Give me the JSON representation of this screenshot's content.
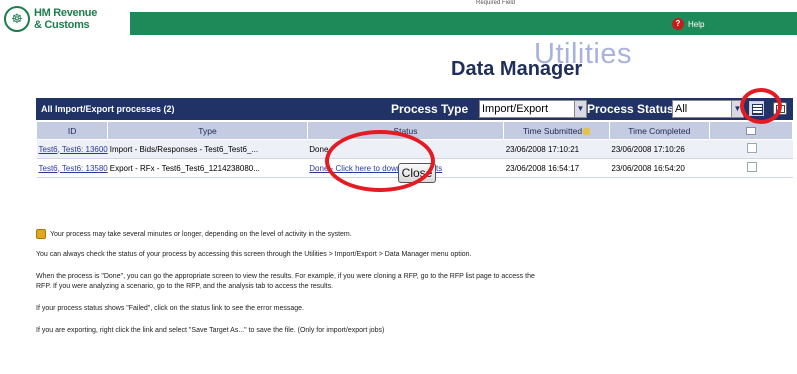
{
  "header": {
    "logo_text_1": "HM Revenue",
    "logo_text_2": "& Customs",
    "logo_crest": "☸",
    "required_field": "Required Field",
    "help_label": "Help",
    "help_icon": "question-circle-icon"
  },
  "title": {
    "watermark": "Utilities",
    "main": "Data Manager"
  },
  "process_bar": {
    "title": "All Import/Export processes (2)",
    "type_label": "Process Type",
    "type_value": "Import/Export",
    "status_label": "Process Status",
    "status_value": "All"
  },
  "table": {
    "headers": {
      "id": "ID",
      "type": "Type",
      "status": "Status",
      "submitted": "Time Submitted",
      "completed": "Time Completed"
    },
    "rows": [
      {
        "id": "Test6, Test6: 13600",
        "type": "Import - Bids/Responses - Test6_Test6_...",
        "status": "Done",
        "submitted": "23/06/2008 17:10:21",
        "completed": "23/06/2008 17:10:26"
      },
      {
        "id": "Test6, Test6: 13580",
        "type": "Export - RFx - Test6_Test6_1214238080...",
        "status": "Done - Click here to download results",
        "submitted": "23/06/2008 16:54:17",
        "completed": "23/06/2008 16:54:20"
      }
    ]
  },
  "close_button": "Close",
  "notes": [
    "Your process may take several minutes or longer, depending on the level of activity in the system.",
    "You can always check the status of your process by accessing this screen through the Utilities > Import/Export > Data Manager menu option.",
    "When the process is \"Done\", you can go the appropriate screen to view the results. For example, if you were cloning a RFP, go to the RFP list page to access the",
    "RFP. If you were analyzing a scenario, go to the RFP, and the analysis tab to access the results.",
    "If your process status shows \"Failed\", click on the status link to see the error message.",
    "If you are exporting, right click the link and select \"Save Target As...\" to save the file. (Only for import/export jobs)"
  ],
  "colors": {
    "brand_green": "#1e8a5a",
    "navy": "#213267",
    "highlight_red": "#e51b23"
  }
}
